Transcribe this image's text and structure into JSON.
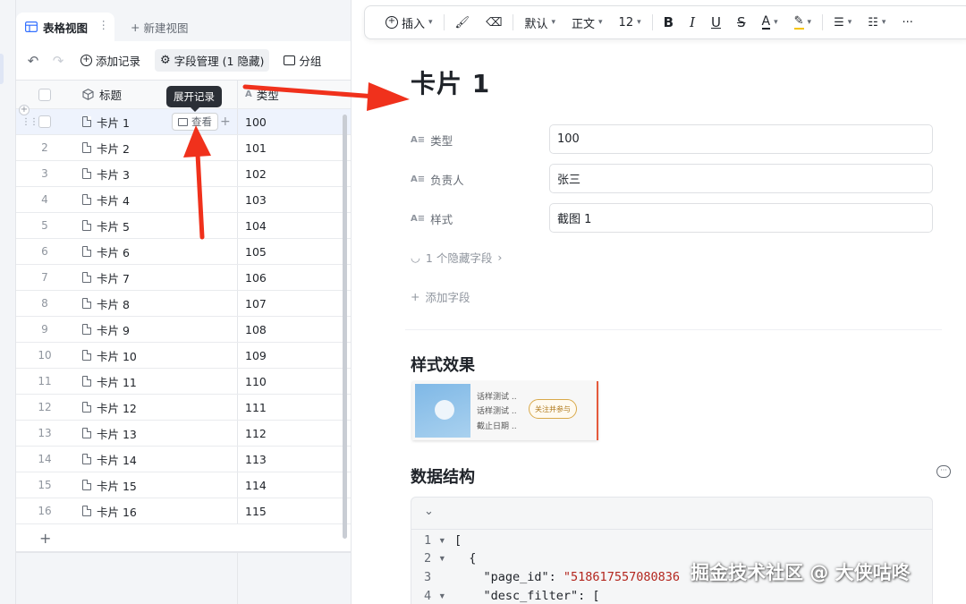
{
  "left": {
    "view_tab": {
      "label": "表格视图",
      "more": "⋮"
    },
    "new_view": {
      "plus": "+",
      "label": "新建视图"
    },
    "toolbar": {
      "undo": "↶",
      "redo": "↷",
      "add_record": "添加记录",
      "field_manage": "字段管理 (1 隐藏)",
      "group": "分组"
    },
    "grid": {
      "col_title": "标题",
      "col_type": "类型",
      "tooltip": "展开记录",
      "view_button": "查看",
      "rows": [
        {
          "num": "",
          "title": "卡片 1",
          "type": "100"
        },
        {
          "num": "2",
          "title": "卡片 2",
          "type": "101"
        },
        {
          "num": "3",
          "title": "卡片 3",
          "type": "102"
        },
        {
          "num": "4",
          "title": "卡片 4",
          "type": "103"
        },
        {
          "num": "5",
          "title": "卡片 5",
          "type": "104"
        },
        {
          "num": "6",
          "title": "卡片 6",
          "type": "105"
        },
        {
          "num": "7",
          "title": "卡片 7",
          "type": "106"
        },
        {
          "num": "8",
          "title": "卡片 8",
          "type": "107"
        },
        {
          "num": "9",
          "title": "卡片 9",
          "type": "108"
        },
        {
          "num": "10",
          "title": "卡片 10",
          "type": "109"
        },
        {
          "num": "11",
          "title": "卡片 11",
          "type": "110"
        },
        {
          "num": "12",
          "title": "卡片 12",
          "type": "111"
        },
        {
          "num": "13",
          "title": "卡片 13",
          "type": "112"
        },
        {
          "num": "14",
          "title": "卡片 14",
          "type": "113"
        },
        {
          "num": "15",
          "title": "卡片 15",
          "type": "114"
        },
        {
          "num": "16",
          "title": "卡片 16",
          "type": "115"
        }
      ],
      "add_row": "+"
    }
  },
  "right": {
    "toolbar": {
      "insert": "插入",
      "style_default": "默认",
      "text_style": "正文",
      "font_size": "12",
      "bold": "B",
      "italic": "I",
      "underline": "U",
      "strike": "S",
      "font_color": "A",
      "more": "···"
    },
    "title": "卡片 1",
    "fields": [
      {
        "label": "类型",
        "value": "100"
      },
      {
        "label": "负责人",
        "value": "张三"
      },
      {
        "label": "样式",
        "value": "截图 1"
      }
    ],
    "hidden_fields": "1 个隐藏字段",
    "add_field": "添加字段",
    "section_style": "样式效果",
    "preview": {
      "line1": "话样测试 ..",
      "line2": "话样测试 ..",
      "line3": "截止日期 ..",
      "follow_btn": "关注并参与"
    },
    "section_data": "数据结构",
    "code": {
      "l1": "[",
      "l2": "  {",
      "l3_key": "    \"page_id\": ",
      "l3_val": "\"518617557080836",
      "l4_key": "    \"desc_filter\": ["
    }
  },
  "watermark": "掘金技术社区 @ 大侠咕咚",
  "colors": {
    "accent_arrow": "#f0311c",
    "active_row": "#eef3fd"
  }
}
